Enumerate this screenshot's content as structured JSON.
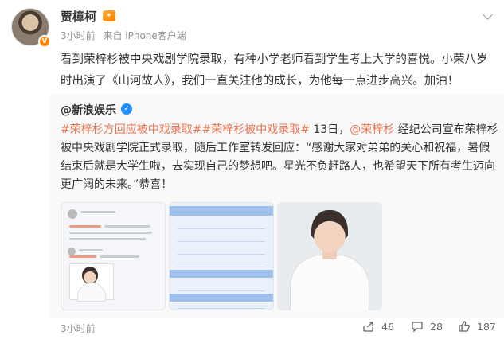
{
  "post": {
    "author": "贾樟柯",
    "time": "3小时前",
    "source": "来自 iPhone客户端",
    "text": "看到荣梓杉被中央戏剧学院录取，有种小学老师看到学生考上大学的喜悦。小荣八岁时出演了《山河故人》，我们一直关注他的成长，为他每一点进步高兴。加油！"
  },
  "repost": {
    "author": "@新浪娱乐",
    "text_parts": {
      "topic1": "#荣梓杉方回应被中戏录取#",
      "topic2": "#荣梓杉被中戏录取#",
      "seg1": " 13日，",
      "mention": "@荣梓杉",
      "seg2": " 经纪公司宣布荣梓杉被中央戏剧学院正式录取，随后工作室转发回应：“感谢大家对弟弟的关心和祝福，暑假结束后就是大学生啦，去实现自己的梦想吧。星光不负赶路人，也希望天下所有考生迈向更广阔的未来。”恭喜！"
    }
  },
  "footer": {
    "time": "3小时前",
    "share_count": "46",
    "comment_count": "28",
    "like_count": "187"
  },
  "colors": {
    "topic": "#eb7350",
    "verified_blue": "#1d8dff",
    "verified_orange": "#ff8200",
    "muted": "#939393"
  },
  "icons": [
    "vip-icon",
    "verified-icon",
    "chevron-down-icon",
    "share-icon",
    "comment-icon",
    "like-icon"
  ]
}
